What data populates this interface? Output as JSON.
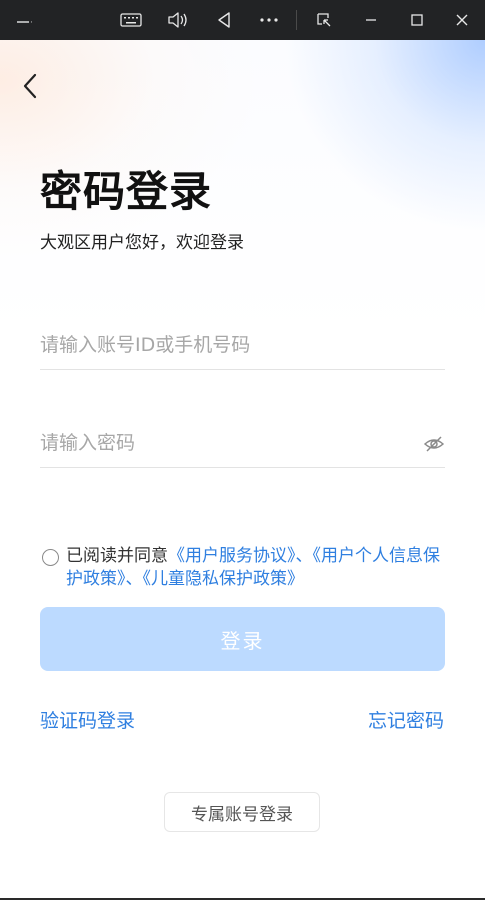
{
  "titlebar": {
    "app_icon_text": "—",
    "buttons": [
      "keyboard-icon",
      "volume-icon",
      "back-triangle-icon",
      "more-icon",
      "window-snap-icon",
      "minimize-icon",
      "maximize-icon",
      "close-icon"
    ]
  },
  "page": {
    "title": "密码登录",
    "subtitle": "大观区用户您好，欢迎登录"
  },
  "form": {
    "account_placeholder": "请输入账号ID或手机号码",
    "account_value": "",
    "password_placeholder": "请输入密码",
    "password_value": ""
  },
  "agreement": {
    "prefix": "已阅读并同意",
    "user_agreement": "《用户服务协议》",
    "sep1": "、",
    "privacy_policy": "《用户个人信息保护政策》",
    "sep2": "、",
    "children_policy": "《儿童隐私保护政策》",
    "checked": false
  },
  "actions": {
    "login": "登录",
    "sms_login": "验证码登录",
    "forgot_password": "忘记密码",
    "exclusive_login": "专属账号登录"
  },
  "colors": {
    "accent": "#2f7fe0",
    "login_disabled_bg": "#bcdaff",
    "titlebar_bg": "#222325"
  }
}
